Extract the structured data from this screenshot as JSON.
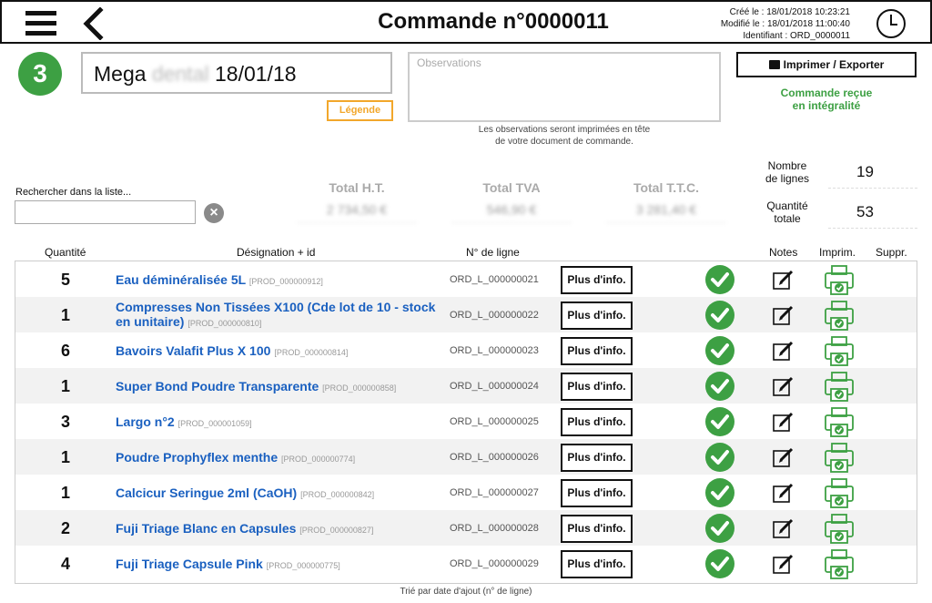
{
  "header": {
    "title": "Commande n°0000011",
    "created": "Créé le : 18/01/2018 10:23:21",
    "modified": "Modifié le : 18/01/2018 11:00:40",
    "identifier": "Identifiant : ORD_0000011"
  },
  "order": {
    "step": "3",
    "name_prefix": "Mega",
    "name_blurred": "dental",
    "date": "18/01/18",
    "legend_label": "Légende",
    "observations_placeholder": "Observations",
    "observations_note_line1": "Les observations seront imprimées en tête",
    "observations_note_line2": "de votre document de commande.",
    "print_label": "Imprimer / Exporter",
    "status_line1": "Commande reçue",
    "status_line2": "en intégralité"
  },
  "search": {
    "label": "Rechercher dans la liste...",
    "value": "",
    "clear_symbol": "×"
  },
  "totals": {
    "ht_label": "Total H.T.",
    "ht_value": "2 734,50 €",
    "tva_label": "Total TVA",
    "tva_value": "546,90 €",
    "ttc_label": "Total T.T.C.",
    "ttc_value": "3 281,40 €"
  },
  "counts": {
    "lines_label_1": "Nombre",
    "lines_label_2": "de lignes",
    "lines_value": "19",
    "qty_label_1": "Quantité",
    "qty_label_2": "totale",
    "qty_value": "53"
  },
  "columns": {
    "quantity": "Quantité",
    "designation": "Désignation + id",
    "line_no": "N° de ligne",
    "notes": "Notes",
    "print": "Imprim.",
    "delete": "Suppr."
  },
  "info_button_label": "Plus d'info.",
  "rows": [
    {
      "qty": "5",
      "name": "Eau déminéralisée 5L",
      "pid": "[PROD_000000912]",
      "line": "ORD_L_000000021"
    },
    {
      "qty": "1",
      "name": "Compresses Non Tissées X100 (Cde lot de 10 - stock en unitaire)",
      "pid": "[PROD_000000810]",
      "line": "ORD_L_000000022"
    },
    {
      "qty": "6",
      "name": "Bavoirs Valafit Plus X 100",
      "pid": "[PROD_000000814]",
      "line": "ORD_L_000000023"
    },
    {
      "qty": "1",
      "name": "Super Bond Poudre Transparente",
      "pid": "[PROD_000000858]",
      "line": "ORD_L_000000024"
    },
    {
      "qty": "3",
      "name": "Largo n°2",
      "pid": "[PROD_000001059]",
      "line": "ORD_L_000000025"
    },
    {
      "qty": "1",
      "name": "Poudre Prophyflex menthe",
      "pid": "[PROD_000000774]",
      "line": "ORD_L_000000026"
    },
    {
      "qty": "1",
      "name": "Calcicur Seringue 2ml (CaOH)",
      "pid": "[PROD_000000842]",
      "line": "ORD_L_000000027"
    },
    {
      "qty": "2",
      "name": "Fuji Triage Blanc en Capsules",
      "pid": "[PROD_000000827]",
      "line": "ORD_L_000000028"
    },
    {
      "qty": "4",
      "name": "Fuji Triage Capsule Pink",
      "pid": "[PROD_000000775]",
      "line": "ORD_L_000000029"
    }
  ],
  "sort_note": "Trié par date d'ajout (n° de ligne)",
  "colors": {
    "green": "#3da043",
    "orange": "#f2a72b",
    "link_blue": "#1a60c0"
  },
  "icons": {
    "menu": "hamburger-icon",
    "back": "chevron-left-icon",
    "history": "clock-icon",
    "print": "printer-icon",
    "received": "check-circle-icon",
    "note": "edit-note-icon",
    "print_line": "printer-check-icon"
  }
}
